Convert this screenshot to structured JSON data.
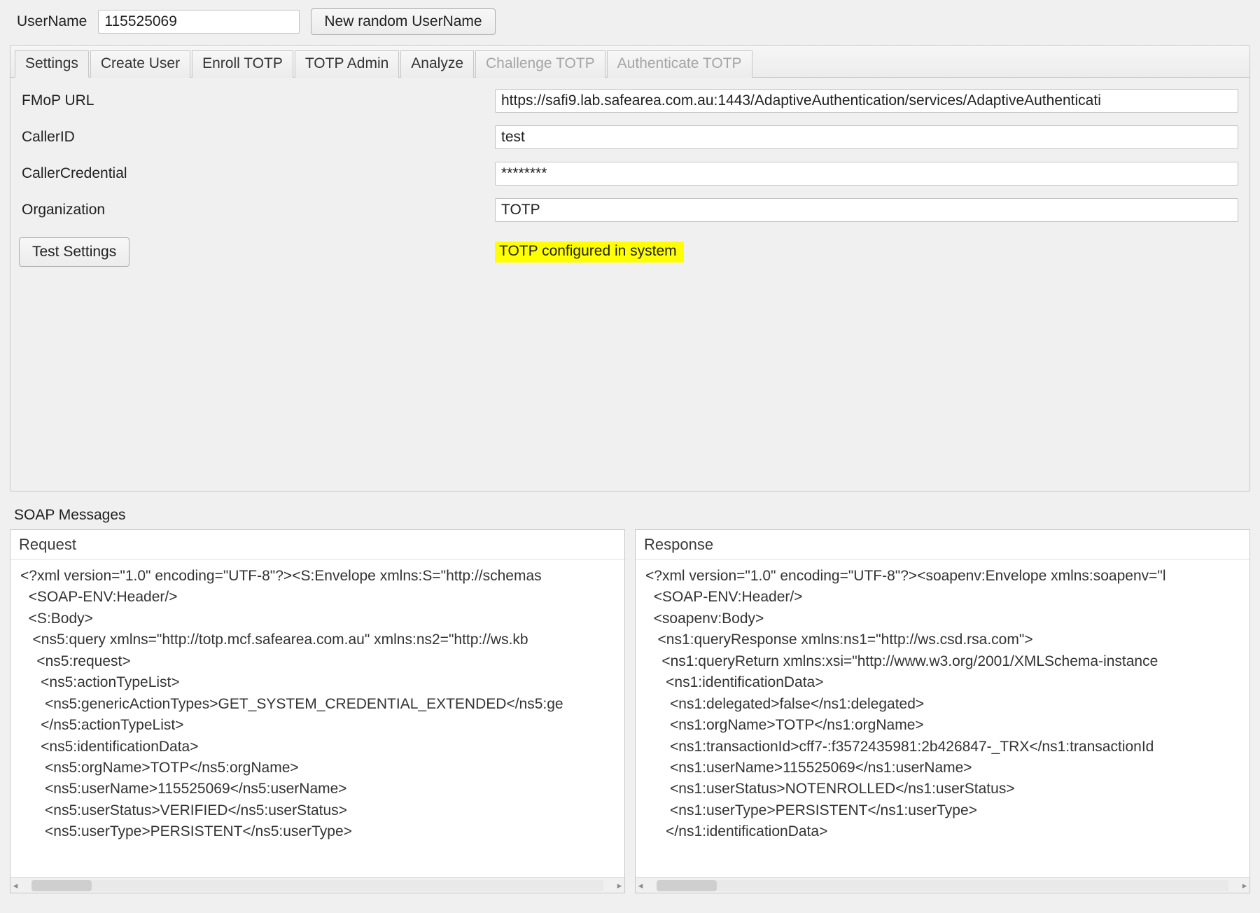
{
  "top": {
    "username_label": "UserName",
    "username_value": "115525069",
    "random_button": "New random UserName"
  },
  "tabs": [
    {
      "label": "Settings",
      "active": true,
      "disabled": false
    },
    {
      "label": "Create User",
      "active": false,
      "disabled": false
    },
    {
      "label": "Enroll TOTP",
      "active": false,
      "disabled": false
    },
    {
      "label": "TOTP Admin",
      "active": false,
      "disabled": false
    },
    {
      "label": "Analyze",
      "active": false,
      "disabled": false
    },
    {
      "label": "Challenge TOTP",
      "active": false,
      "disabled": true
    },
    {
      "label": "Authenticate TOTP",
      "active": false,
      "disabled": true
    }
  ],
  "settings": {
    "fmop_label": "FMoP URL",
    "fmop_value": "https://safi9.lab.safearea.com.au:1443/AdaptiveAuthentication/services/AdaptiveAuthenticati",
    "callerid_label": "CallerID",
    "callerid_value": "test",
    "callercred_label": "CallerCredential",
    "callercred_value": "********",
    "org_label": "Organization",
    "org_value": "TOTP",
    "test_button": "Test Settings",
    "status_message": "TOTP configured in system"
  },
  "soap": {
    "section_title": "SOAP Messages",
    "request_title": "Request",
    "response_title": "Response",
    "request_body": "<?xml version=\"1.0\" encoding=\"UTF-8\"?><S:Envelope xmlns:S=\"http://schemas\n  <SOAP-ENV:Header/>\n  <S:Body>\n   <ns5:query xmlns=\"http://totp.mcf.safearea.com.au\" xmlns:ns2=\"http://ws.kb\n    <ns5:request>\n     <ns5:actionTypeList>\n      <ns5:genericActionTypes>GET_SYSTEM_CREDENTIAL_EXTENDED</ns5:ge\n     </ns5:actionTypeList>\n     <ns5:identificationData>\n      <ns5:orgName>TOTP</ns5:orgName>\n      <ns5:userName>115525069</ns5:userName>\n      <ns5:userStatus>VERIFIED</ns5:userStatus>\n      <ns5:userType>PERSISTENT</ns5:userType>",
    "response_body": "<?xml version=\"1.0\" encoding=\"UTF-8\"?><soapenv:Envelope xmlns:soapenv=\"l\n  <SOAP-ENV:Header/>\n  <soapenv:Body>\n   <ns1:queryResponse xmlns:ns1=\"http://ws.csd.rsa.com\">\n    <ns1:queryReturn xmlns:xsi=\"http://www.w3.org/2001/XMLSchema-instance\n     <ns1:identificationData>\n      <ns1:delegated>false</ns1:delegated>\n      <ns1:orgName>TOTP</ns1:orgName>\n      <ns1:transactionId>cff7-:f3572435981:2b426847-_TRX</ns1:transactionId\n      <ns1:userName>115525069</ns1:userName>\n      <ns1:userStatus>NOTENROLLED</ns1:userStatus>\n      <ns1:userType>PERSISTENT</ns1:userType>\n     </ns1:identificationData>"
  }
}
